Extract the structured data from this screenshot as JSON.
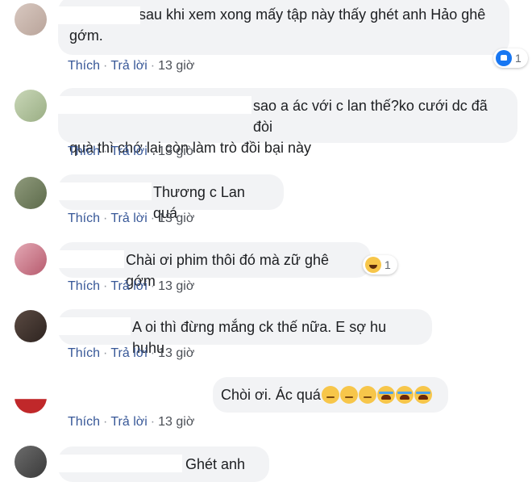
{
  "actions": {
    "like": "Thích",
    "reply": "Trả lời",
    "sep": "·"
  },
  "colors": {
    "bubble": "#f2f3f5",
    "link": "#385898",
    "like_blue": "#1877f2"
  },
  "comments": [
    {
      "lines": [
        "sau khi xem xong mấy tập này thấy ghét anh Hảo ghê",
        "gớm."
      ],
      "time": "13 giờ",
      "reaction": {
        "icon": "like-icon",
        "count": "1"
      }
    },
    {
      "lines": [
        "sao a ác với c lan thế?ko cưới dc đã đòi",
        "quà thì chớ lại còn làm trò đồi bại này"
      ],
      "time": "13 giờ"
    },
    {
      "lines": [
        "Thương c Lan quá"
      ],
      "time": "13 giờ"
    },
    {
      "lines": [
        "Chài ơi phim thôi đó mà zữ ghê gớm"
      ],
      "time": "13 giờ",
      "reaction": {
        "icon": "haha-icon",
        "count": "1"
      }
    },
    {
      "lines": [
        "A oi thì đừng mắng ck thế nữa. E sợ hu huhu"
      ],
      "time": "13 giờ"
    },
    {
      "lines": [
        "Chòi ơi. Ác quá"
      ],
      "time": "13 giờ",
      "emojis": [
        "pensive-emoji",
        "pensive-emoji",
        "pensive-emoji",
        "crying-emoji",
        "crying-emoji",
        "crying-emoji"
      ]
    },
    {
      "lines": [
        "Ghét anh"
      ]
    }
  ]
}
